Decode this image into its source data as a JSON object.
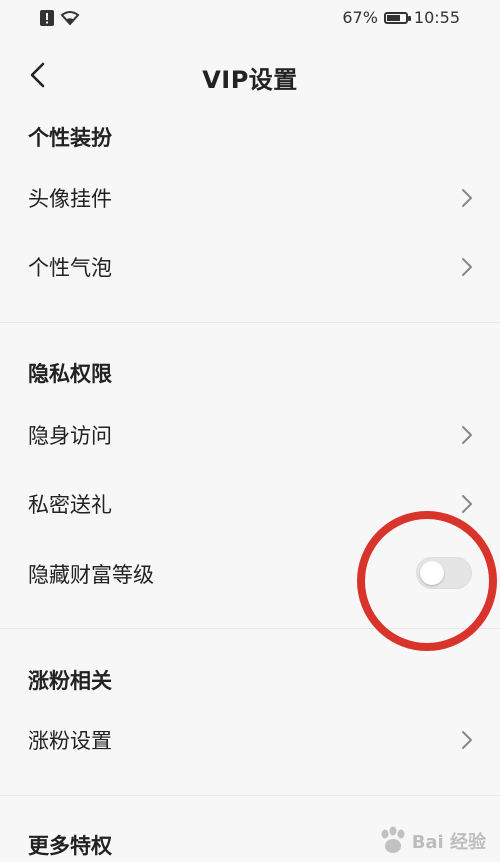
{
  "status_bar": {
    "battery_percent_label": "67%",
    "battery_level": 0.67,
    "time": "10:55"
  },
  "header": {
    "title": "VIP设置",
    "back_icon": "chevron-left-icon"
  },
  "sections": [
    {
      "title": "个性装扮",
      "items": [
        {
          "label": "头像挂件",
          "control": "chevron"
        },
        {
          "label": "个性气泡",
          "control": "chevron"
        }
      ]
    },
    {
      "title": "隐私权限",
      "items": [
        {
          "label": "隐身访问",
          "control": "chevron"
        },
        {
          "label": "私密送礼",
          "control": "chevron"
        },
        {
          "label": "隐藏财富等级",
          "control": "toggle",
          "toggle_on": false
        }
      ]
    },
    {
      "title": "涨粉相关",
      "items": [
        {
          "label": "涨粉设置",
          "control": "chevron"
        }
      ]
    },
    {
      "title": "更多特权",
      "items": []
    }
  ],
  "annotation": {
    "shape": "circle",
    "color": "#d9342b"
  },
  "watermark": {
    "text": "Bai 经验"
  }
}
